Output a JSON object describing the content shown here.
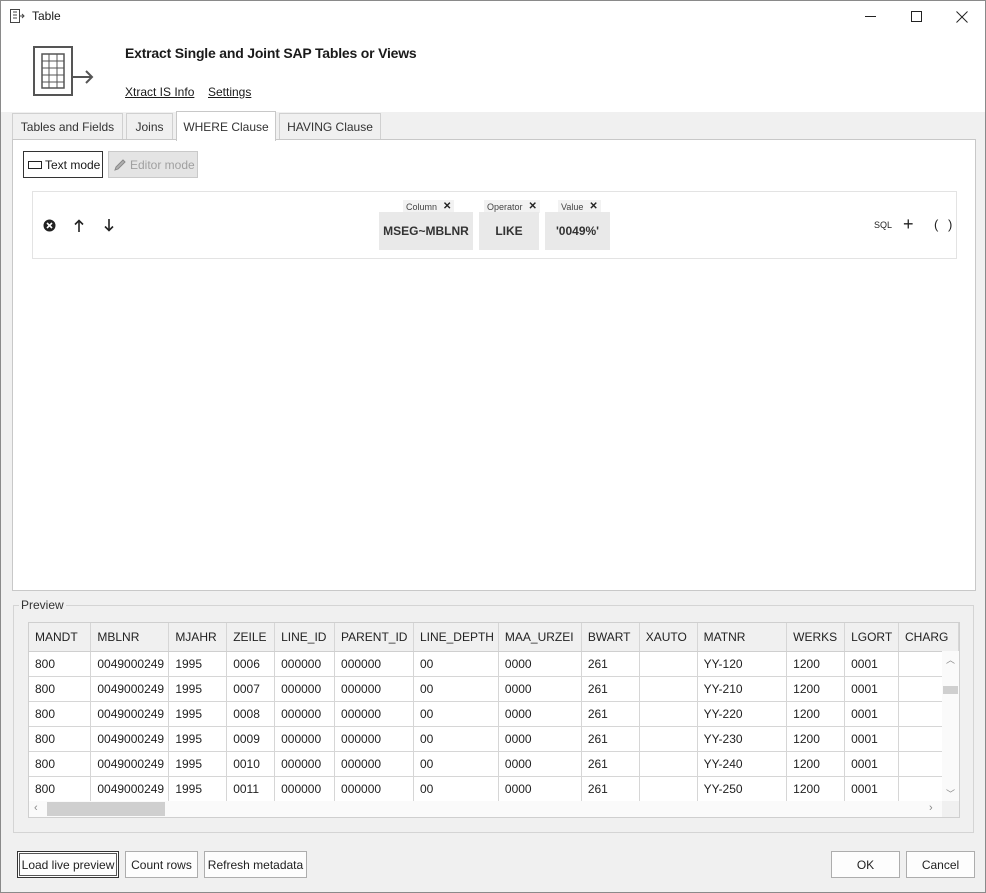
{
  "window": {
    "title": "Table"
  },
  "header": {
    "heading": "Extract Single and Joint SAP Tables or Views",
    "links": [
      "Xtract IS Info",
      "Settings"
    ]
  },
  "tabs": [
    "Tables and Fields",
    "Joins",
    "WHERE Clause",
    "HAVING Clause"
  ],
  "active_tab": "WHERE Clause",
  "modes": {
    "text": "Text mode",
    "editor": "Editor mode"
  },
  "clause": {
    "column_label": "Column",
    "column_value": "MSEG~MBLNR",
    "operator_label": "Operator",
    "operator_value": "LIKE",
    "value_label": "Value",
    "value_value": "'0049%'",
    "sql_label": "SQL",
    "plus_label": "+",
    "paren_label": "( )"
  },
  "preview": {
    "label": "Preview",
    "columns": [
      "MANDT",
      "MBLNR",
      "MJAHR",
      "ZEILE",
      "LINE_ID",
      "PARENT_ID",
      "LINE_DEPTH",
      "MAA_URZEI",
      "BWART",
      "XAUTO",
      "MATNR",
      "WERKS",
      "LGORT",
      "CHARG"
    ],
    "rows": [
      [
        "800",
        "0049000249",
        "1995",
        "0006",
        "000000",
        "000000",
        "00",
        "0000",
        "261",
        "",
        "YY-120",
        "1200",
        "0001",
        ""
      ],
      [
        "800",
        "0049000249",
        "1995",
        "0007",
        "000000",
        "000000",
        "00",
        "0000",
        "261",
        "",
        "YY-210",
        "1200",
        "0001",
        ""
      ],
      [
        "800",
        "0049000249",
        "1995",
        "0008",
        "000000",
        "000000",
        "00",
        "0000",
        "261",
        "",
        "YY-220",
        "1200",
        "0001",
        ""
      ],
      [
        "800",
        "0049000249",
        "1995",
        "0009",
        "000000",
        "000000",
        "00",
        "0000",
        "261",
        "",
        "YY-230",
        "1200",
        "0001",
        ""
      ],
      [
        "800",
        "0049000249",
        "1995",
        "0010",
        "000000",
        "000000",
        "00",
        "0000",
        "261",
        "",
        "YY-240",
        "1200",
        "0001",
        ""
      ],
      [
        "800",
        "0049000249",
        "1995",
        "0011",
        "000000",
        "000000",
        "00",
        "0000",
        "261",
        "",
        "YY-250",
        "1200",
        "0001",
        ""
      ]
    ]
  },
  "buttons": {
    "load_live_preview": "Load live preview",
    "count_rows": "Count rows",
    "refresh_metadata": "Refresh metadata",
    "ok": "OK",
    "cancel": "Cancel"
  }
}
